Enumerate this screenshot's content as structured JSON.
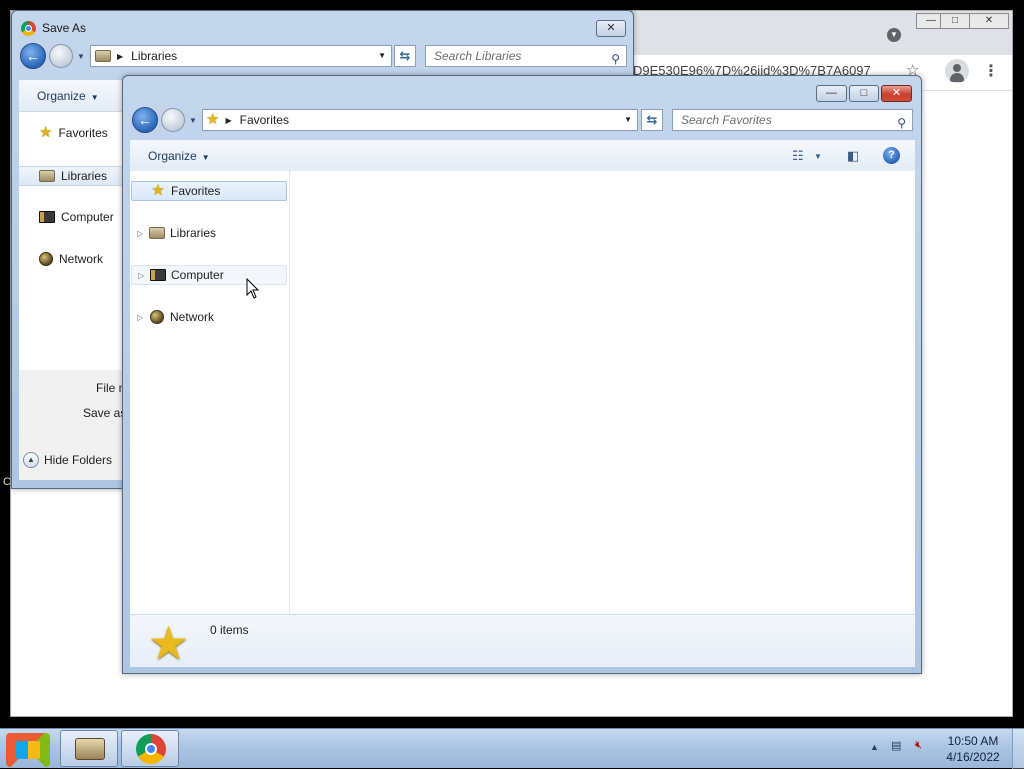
{
  "chrome": {
    "url_fragment": "D9E530E96%7D%26iid%3D%7B7A6097",
    "minimize": "—",
    "restore": "□",
    "close": "✕"
  },
  "stray_text": "C",
  "save_as": {
    "title": "Save As",
    "close": "✕",
    "address": "Libraries",
    "search_placeholder": "Search Libraries",
    "organize": "Organize",
    "nav_items": [
      {
        "label": "Favorites",
        "icon": "star-icon"
      },
      {
        "label": "Libraries",
        "icon": "library-icon"
      },
      {
        "label": "Computer",
        "icon": "computer-icon"
      },
      {
        "label": "Network",
        "icon": "network-icon"
      }
    ],
    "file_name_label": "File nar",
    "save_as_type_label": "Save as ty",
    "hide_folders": "Hide Folders"
  },
  "explorer": {
    "minimize": "—",
    "maximize": "□",
    "close": "✕",
    "address": "Favorites",
    "search_placeholder": "Search Favorites",
    "organize": "Organize",
    "tree": [
      {
        "label": "Favorites",
        "icon": "star-icon",
        "selected": true
      },
      {
        "label": "Libraries",
        "icon": "library-icon"
      },
      {
        "label": "Computer",
        "icon": "computer-icon",
        "hover": true
      },
      {
        "label": "Network",
        "icon": "network-icon"
      }
    ],
    "item_count": "0 items"
  },
  "taskbar": {
    "time": "10:50 AM",
    "date": "4/16/2022"
  }
}
